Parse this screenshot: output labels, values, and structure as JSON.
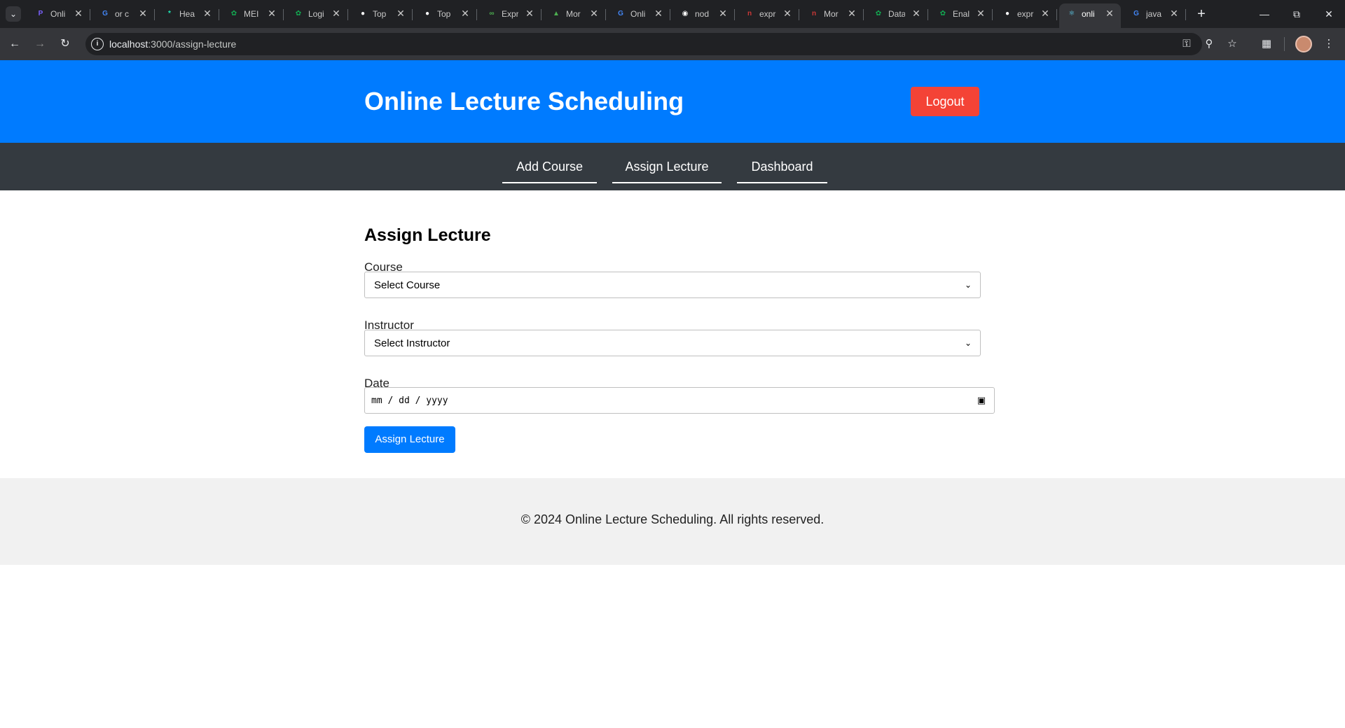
{
  "browser": {
    "tabs": [
      {
        "title": "Onli",
        "icon": "app-icon",
        "color": "#7b61ff"
      },
      {
        "title": "or c",
        "icon": "google-icon",
        "color": "#4285f4"
      },
      {
        "title": "Hea",
        "icon": "asterisk-icon",
        "color": "#1de9b6"
      },
      {
        "title": "MEI",
        "icon": "leaf-icon",
        "color": "#13aa52"
      },
      {
        "title": "Logi",
        "icon": "leaf-icon",
        "color": "#13aa52"
      },
      {
        "title": "Top",
        "icon": "medium-icon",
        "color": "#ffffff"
      },
      {
        "title": "Top",
        "icon": "medium-icon",
        "color": "#ffffff"
      },
      {
        "title": "Expr",
        "icon": "infinity-icon",
        "color": "#4caf50"
      },
      {
        "title": "Mor",
        "icon": "mongo-icon",
        "color": "#4caf50"
      },
      {
        "title": "Onli",
        "icon": "google-icon",
        "color": "#4285f4"
      },
      {
        "title": "nod",
        "icon": "github-icon",
        "color": "#ffffff"
      },
      {
        "title": "expr",
        "icon": "npm-icon",
        "color": "#cb3837"
      },
      {
        "title": "Mor",
        "icon": "npm-icon",
        "color": "#cb3837"
      },
      {
        "title": "Data",
        "icon": "leaf-icon",
        "color": "#13aa52"
      },
      {
        "title": "Enal",
        "icon": "leaf-icon",
        "color": "#13aa52"
      },
      {
        "title": "expr",
        "icon": "medium-icon",
        "color": "#ffffff"
      },
      {
        "title": "onli",
        "icon": "react-icon",
        "color": "#61dafb"
      },
      {
        "title": "java",
        "icon": "google-icon",
        "color": "#4285f4"
      }
    ],
    "active_tab_index": 16,
    "url_host": "localhost",
    "url_path": ":3000/assign-lecture"
  },
  "header": {
    "title": "Online Lecture Scheduling",
    "logout_label": "Logout"
  },
  "nav": {
    "items": [
      "Add Course",
      "Assign Lecture",
      "Dashboard"
    ]
  },
  "form": {
    "title": "Assign Lecture",
    "course_label": "Course",
    "course_value": "Select Course",
    "instructor_label": "Instructor",
    "instructor_value": "Select Instructor",
    "date_label": "Date",
    "date_placeholder": "mm / dd / yyyy",
    "submit_label": "Assign Lecture"
  },
  "footer": {
    "text": "© 2024 Online Lecture Scheduling. All rights reserved."
  },
  "colors": {
    "header_bg": "#007bff",
    "nav_bg": "#343a40",
    "logout_bg": "#f44336",
    "button_bg": "#007bff",
    "footer_bg": "#f1f1f1"
  }
}
